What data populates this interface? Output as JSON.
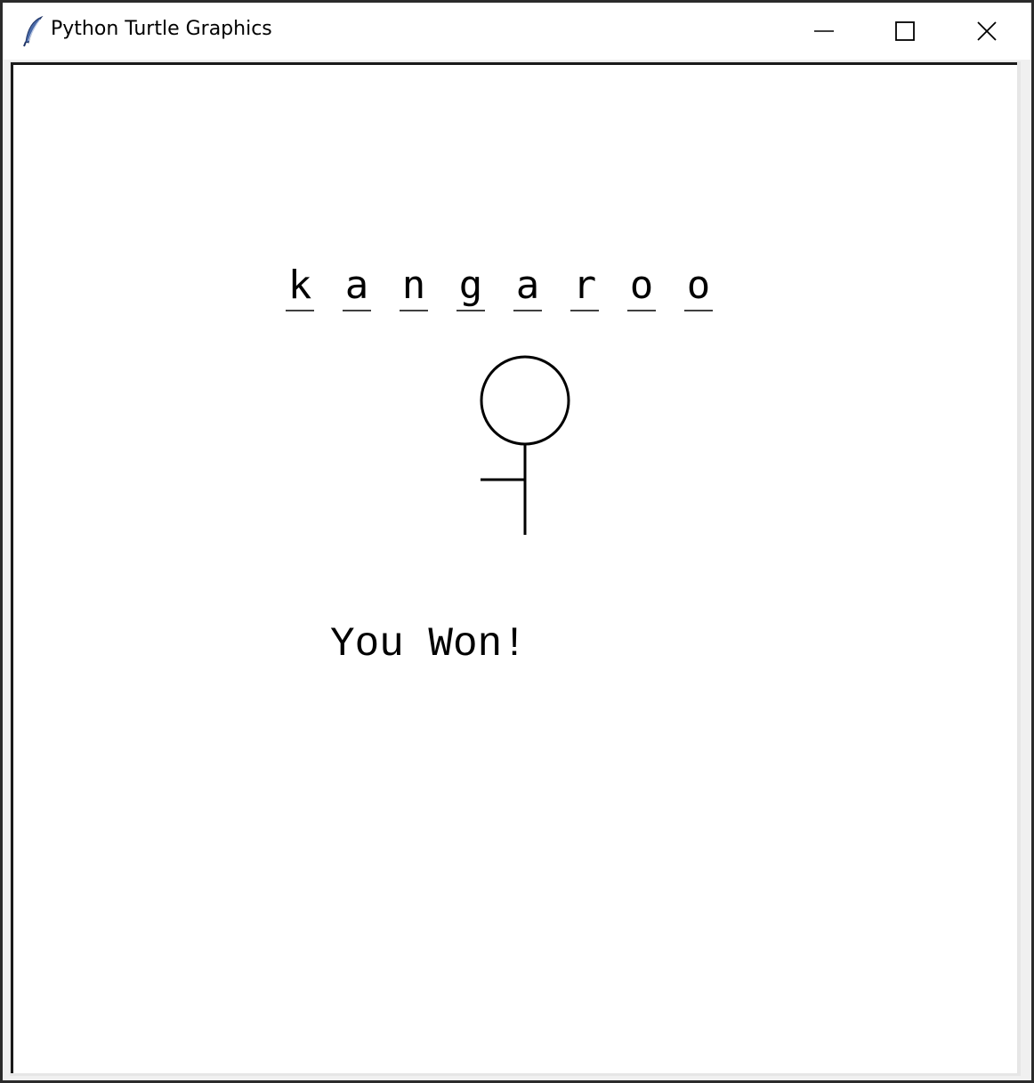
{
  "window": {
    "title": "Python Turtle Graphics",
    "icon": "feather-icon"
  },
  "controls": {
    "minimize_icon": "minimize-icon",
    "maximize_icon": "maximize-icon",
    "close_icon": "close-icon"
  },
  "game": {
    "word_letters": [
      "k",
      "a",
      "n",
      "g",
      "a",
      "r",
      "o",
      "o"
    ],
    "message": "You Won!"
  }
}
